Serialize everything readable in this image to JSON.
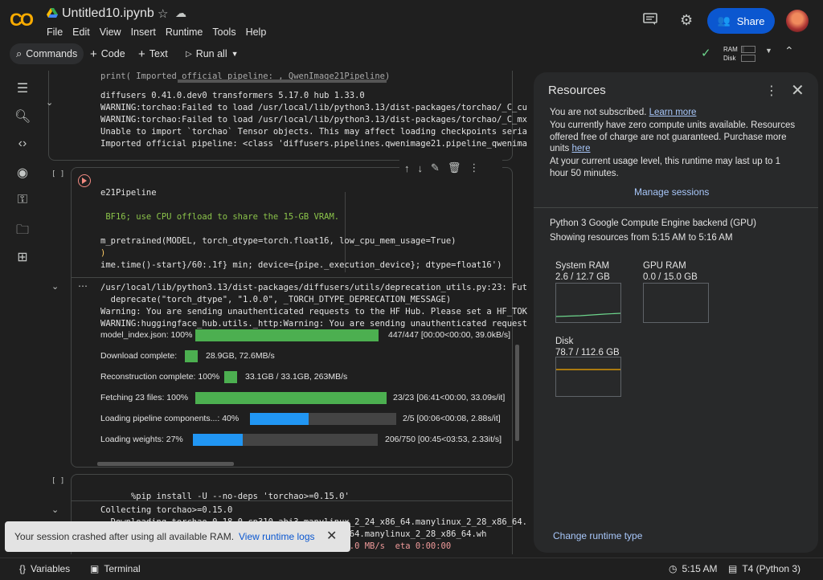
{
  "header": {
    "logo_text": "CO",
    "notebook_title": "Untitled10.ipynb",
    "menu": [
      "File",
      "Edit",
      "View",
      "Insert",
      "Runtime",
      "Tools",
      "Help"
    ],
    "share_label": "Share"
  },
  "toolbar": {
    "commands_label": "Commands",
    "code_label": "Code",
    "text_label": "Text",
    "runall_label": "Run all",
    "ram_label": "RAM",
    "disk_label": "Disk"
  },
  "cell1": {
    "top_code": "print( Imported official pipeline: , QwenImage21Pipeline)",
    "output": [
      "diffusers 0.41.0.dev0 transformers 5.17.0 hub 1.33.0",
      "WARNING:torchao:Failed to load /usr/local/lib/python3.13/dist-packages/torchao/_C_cu",
      "WARNING:torchao:Failed to load /usr/local/lib/python3.13/dist-packages/torchao/_C_mx",
      "Unable to import `torchao` Tensor objects. This may affect loading checkpoints seria",
      "Imported official pipeline: <class 'diffusers.pipelines.qwenimage21.pipeline_qwenima"
    ]
  },
  "cell2": {
    "gutter": "[ ]",
    "code": [
      "e21Pipeline",
      "",
      " BF16; use CPU offload to share the 15-GB VRAM.",
      "",
      "m_pretrained(MODEL, torch_dtype=torch.float16, low_cpu_mem_usage=True)",
      ")",
      "ime.time()-start}/60:.1f} min; device={pipe._execution_device}; dtype=float16')"
    ],
    "output": [
      "/usr/local/lib/python3.13/dist-packages/diffusers/utils/deprecation_utils.py:23: Fut",
      "  deprecate(\"torch_dtype\", \"1.0.0\", _TORCH_DTYPE_DEPRECATION_MESSAGE)",
      "Warning: You are sending unauthenticated requests to the HF Hub. Please set a HF_TOK",
      "WARNING:huggingface_hub.utils._http:Warning: You are sending unauthenticated request"
    ],
    "progress": [
      {
        "label": "model_index.json:  100%",
        "fraction": 1.0,
        "color": "#4caf50",
        "stats": "447/447  [00:00<00:00,  39.0kB/s]"
      },
      {
        "label": "Download  complete:",
        "fraction": 1.0,
        "color": "#4caf50",
        "stats": "28.9GB,  72.6MB/s"
      },
      {
        "label": "Reconstruction  complete:  100%",
        "fraction": 1.0,
        "color": "#4caf50",
        "stats": "33.1GB  /  33.1GB,    263MB/s"
      },
      {
        "label": "Fetching  23  files:  100%",
        "fraction": 1.0,
        "color": "#4caf50",
        "stats": "23/23  [06:41<00:00,  33.09s/it]"
      },
      {
        "label": "Loading  pipeline  components...:   40%",
        "fraction": 0.4,
        "color": "#2196f3",
        "stats": "2/5  [00:06<00:08,    2.88s/it]"
      },
      {
        "label": "Loading  weights:    27%",
        "fraction": 0.27,
        "color": "#2196f3",
        "stats": "206/750  [00:45<03:53,    2.33it/s]"
      }
    ]
  },
  "cell3": {
    "gutter": "[ ]",
    "code": "%pip install -U --no-deps 'torchao>=0.15.0'",
    "output": [
      "Collecting torchao>=0.15.0",
      "  Downloading torchao-0.18.0-cp310-abi3-manylinux_2_24_x86_64.manylinux_2_28_x86_64.",
      "                                           4_x86_64.manylinux_2_28_x86_64.wh",
      "                                           MB  50.0 MB/s  eta 0:00:00"
    ]
  },
  "resources": {
    "title": "Resources",
    "not_subscribed": "You are not subscribed.",
    "learn_more": "Learn more",
    "units_text": "You currently have zero compute units available. Resources offered free of charge are not guaranteed. Purchase more units",
    "here_link": "here",
    "usage_text": "At your current usage level, this runtime may last up to 1 hour 50 minutes.",
    "manage_sessions": "Manage sessions",
    "backend": "Python 3 Google Compute Engine backend (GPU)",
    "showing": "Showing resources from 5:15 AM to 5:16 AM",
    "system_ram_label": "System RAM",
    "system_ram_value": "2.6 / 12.7 GB",
    "gpu_ram_label": "GPU RAM",
    "gpu_ram_value": "0.0 / 15.0 GB",
    "disk_label": "Disk",
    "disk_value": "78.7 / 112.6 GB",
    "change_runtime": "Change runtime type",
    "ram_color": "#6dd58c",
    "disk_color": "#f9ab00"
  },
  "toast": {
    "message": "Your session crashed after using all available RAM.",
    "link": "View runtime logs"
  },
  "statusbar": {
    "variables": "Variables",
    "terminal": "Terminal",
    "time": "5:15 AM",
    "runtime": "T4 (Python 3)"
  }
}
